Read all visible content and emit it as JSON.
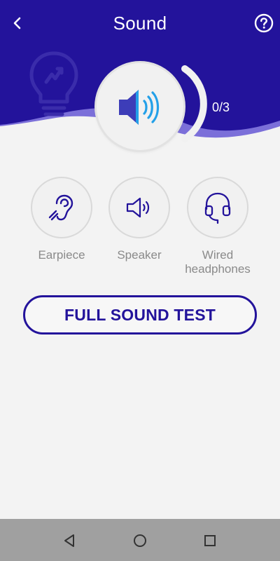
{
  "header": {
    "title": "Sound",
    "back_icon": "chevron-left-icon",
    "help_icon": "question-circle-icon",
    "background_color": "#23139b",
    "wave_color": "#7b6fd9"
  },
  "test_status": {
    "icon": "speaker-volume-icon",
    "progress_text": "0/3",
    "completed": 0,
    "total": 3
  },
  "options": [
    {
      "label": "Earpiece",
      "icon": "ear-icon"
    },
    {
      "label": "Speaker",
      "icon": "speaker-icon"
    },
    {
      "label": "Wired headphones",
      "icon": "headphones-icon"
    }
  ],
  "full_test_button": {
    "label": "FULL SOUND TEST",
    "color": "#23139b"
  },
  "navigation_bar": {
    "back_icon": "nav-back-icon",
    "home_icon": "nav-home-icon",
    "recents_icon": "nav-recents-icon"
  }
}
